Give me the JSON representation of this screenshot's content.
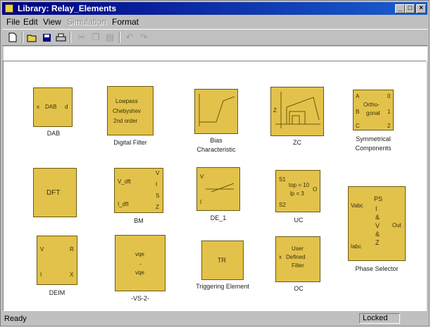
{
  "window": {
    "title": "Library: Relay_Elements",
    "controls": {
      "minimize": "_",
      "maximize": "□",
      "close": "×"
    }
  },
  "menu": [
    "File",
    "Edit",
    "View",
    "Simulation",
    "Format"
  ],
  "toolbar_icons": [
    "new-icon",
    "open-icon",
    "save-icon",
    "print-icon",
    "cut-icon",
    "copy-icon",
    "paste-icon",
    "undo-icon",
    "redo-icon"
  ],
  "blocks": {
    "dab": {
      "label": "DAB",
      "text": "DAB"
    },
    "digital_filter": {
      "label": "Digital Filter",
      "line1": "Lowpass",
      "line2": "Chebyshev",
      "line3": "2nd order"
    },
    "bias": {
      "label1": "Bias",
      "label2": "Characteristic"
    },
    "zc": {
      "label": "ZC",
      "port_left": "Z"
    },
    "sym": {
      "label1": "Symmetrical",
      "label2": "Components",
      "text1": "Ortho-",
      "text2": "gonal",
      "pin_a": "A",
      "pin_b": "B",
      "pin_c": "C",
      "out0": "0",
      "out1": "1",
      "out2": "2"
    },
    "dft": {
      "label": "",
      "text": "DFT"
    },
    "bm": {
      "label": "BM",
      "in1": "V_dft",
      "in2": "I_dft",
      "out1": "V",
      "out2": "I",
      "out3": "S",
      "out4": "Z"
    },
    "de1": {
      "label": "DE_1",
      "in1": "V",
      "in2": "I"
    },
    "uc": {
      "label": "UC",
      "in1": "S1",
      "in2": "S2",
      "t1": "top = 10",
      "t2": "lp = 3",
      "out": "O"
    },
    "phase": {
      "label": "Phase Selector",
      "in1": "Vabc",
      "in2": "Iabc",
      "t1": "PS",
      "t2": "I",
      "t3": "&",
      "t4": "V",
      "t5": "&",
      "t6": "Z",
      "out": "Out"
    },
    "deim": {
      "label": "DEIM",
      "in1": "V",
      "in2": "I",
      "out1": "R",
      "out2": "X"
    },
    "vs2": {
      "label": "-VS-2-",
      "t1": "vqe",
      "t2": "vqe"
    },
    "tr": {
      "label": "Triggering Element",
      "text": "TR"
    },
    "oc": {
      "label": "OC",
      "t1": "User",
      "t2": "Defined",
      "t3": "Filter",
      "in": "x"
    }
  },
  "status": {
    "ready": "Ready",
    "locked": "Locked"
  },
  "colors": {
    "block_fill": "#e2c24a",
    "title_bar": "#000080"
  }
}
